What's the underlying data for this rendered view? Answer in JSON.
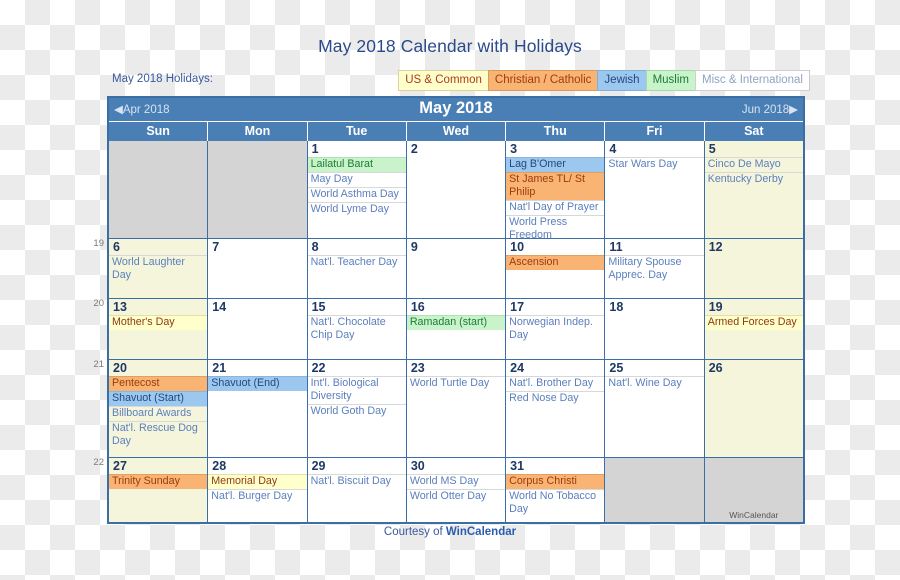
{
  "page": {
    "title": "May 2018 Calendar with Holidays"
  },
  "legend": {
    "label": "May 2018 Holidays:",
    "items": [
      {
        "label": "US & Common",
        "key": "us",
        "color": "#ffffcc"
      },
      {
        "label": "Christian / Catholic",
        "key": "chr",
        "color": "#f9b473"
      },
      {
        "label": "Jewish",
        "key": "jew",
        "color": "#9cc8f0"
      },
      {
        "label": "Muslim",
        "key": "mus",
        "color": "#c9f3cb"
      },
      {
        "label": "Misc & International",
        "key": "misc",
        "color": "#ffffff"
      }
    ]
  },
  "calendar": {
    "prev_label": "◀Apr 2018",
    "month_label": "May 2018",
    "next_label": "Jun 2018▶",
    "day_headers": [
      "Sun",
      "Mon",
      "Tue",
      "Wed",
      "Thu",
      "Fri",
      "Sat"
    ],
    "week_numbers": [
      "19",
      "20",
      "21",
      "22"
    ],
    "brand_cell_text": "WinCalendar",
    "weeks": [
      {
        "days": [
          {
            "num": "",
            "blank": true,
            "events": []
          },
          {
            "num": "",
            "blank": true,
            "events": []
          },
          {
            "num": "1",
            "events": [
              {
                "text": "Lailatul Barat",
                "type": "mus"
              },
              {
                "text": "May Day",
                "type": "misc"
              },
              {
                "text": "World Asthma Day",
                "type": "misc"
              },
              {
                "text": "World Lyme Day",
                "type": "misc"
              }
            ]
          },
          {
            "num": "2",
            "events": []
          },
          {
            "num": "3",
            "events": [
              {
                "text": "Lag B'Omer",
                "type": "jew"
              },
              {
                "text": "St James TL/ St Philip",
                "type": "chr"
              },
              {
                "text": "Nat'l Day of Prayer",
                "type": "misc"
              },
              {
                "text": "World Press Freedom",
                "type": "misc"
              }
            ]
          },
          {
            "num": "4",
            "events": [
              {
                "text": "Star Wars Day",
                "type": "misc"
              }
            ]
          },
          {
            "num": "5",
            "weekend": true,
            "events": [
              {
                "text": "Cinco De Mayo",
                "type": "misc"
              },
              {
                "text": "Kentucky Derby",
                "type": "misc"
              }
            ]
          }
        ]
      },
      {
        "days": [
          {
            "num": "6",
            "weekend": true,
            "events": [
              {
                "text": "World Laughter Day",
                "type": "misc"
              }
            ]
          },
          {
            "num": "7",
            "events": []
          },
          {
            "num": "8",
            "events": [
              {
                "text": "Nat'l. Teacher Day",
                "type": "misc"
              }
            ]
          },
          {
            "num": "9",
            "events": []
          },
          {
            "num": "10",
            "events": [
              {
                "text": "Ascension",
                "type": "chr"
              }
            ]
          },
          {
            "num": "11",
            "events": [
              {
                "text": "Military Spouse Apprec. Day",
                "type": "misc"
              }
            ]
          },
          {
            "num": "12",
            "weekend": true,
            "events": []
          }
        ]
      },
      {
        "days": [
          {
            "num": "13",
            "weekend": true,
            "events": [
              {
                "text": "Mother's Day",
                "type": "us"
              }
            ]
          },
          {
            "num": "14",
            "events": []
          },
          {
            "num": "15",
            "events": [
              {
                "text": "Nat'l. Chocolate Chip Day",
                "type": "misc"
              }
            ]
          },
          {
            "num": "16",
            "events": [
              {
                "text": "Ramadan (start)",
                "type": "mus"
              }
            ]
          },
          {
            "num": "17",
            "events": [
              {
                "text": "Norwegian Indep. Day",
                "type": "misc"
              }
            ]
          },
          {
            "num": "18",
            "events": []
          },
          {
            "num": "19",
            "weekend": true,
            "events": [
              {
                "text": "Armed Forces Day",
                "type": "us"
              }
            ]
          }
        ]
      },
      {
        "days": [
          {
            "num": "20",
            "weekend": true,
            "events": [
              {
                "text": "Pentecost",
                "type": "chr"
              },
              {
                "text": "Shavuot (Start)",
                "type": "jew"
              },
              {
                "text": "Billboard Awards",
                "type": "misc"
              },
              {
                "text": "Nat'l. Rescue Dog Day",
                "type": "misc"
              }
            ]
          },
          {
            "num": "21",
            "events": [
              {
                "text": "Shavuot (End)",
                "type": "jew"
              }
            ]
          },
          {
            "num": "22",
            "events": [
              {
                "text": "Int'l. Biological Diversity",
                "type": "misc"
              },
              {
                "text": "World Goth Day",
                "type": "misc"
              }
            ]
          },
          {
            "num": "23",
            "events": [
              {
                "text": "World Turtle Day",
                "type": "misc"
              }
            ]
          },
          {
            "num": "24",
            "events": [
              {
                "text": "Nat'l. Brother Day",
                "type": "misc"
              },
              {
                "text": "Red Nose Day",
                "type": "misc"
              }
            ]
          },
          {
            "num": "25",
            "events": [
              {
                "text": "Nat'l. Wine Day",
                "type": "misc"
              }
            ]
          },
          {
            "num": "26",
            "weekend": true,
            "events": []
          }
        ]
      },
      {
        "days": [
          {
            "num": "27",
            "weekend": true,
            "events": [
              {
                "text": "Trinity Sunday",
                "type": "chr"
              }
            ]
          },
          {
            "num": "28",
            "events": [
              {
                "text": "Memorial Day",
                "type": "us"
              },
              {
                "text": "Nat'l. Burger Day",
                "type": "misc"
              }
            ]
          },
          {
            "num": "29",
            "events": [
              {
                "text": "Nat'l. Biscuit Day",
                "type": "misc"
              }
            ]
          },
          {
            "num": "30",
            "events": [
              {
                "text": "World MS Day",
                "type": "misc"
              },
              {
                "text": "World Otter Day",
                "type": "misc"
              }
            ]
          },
          {
            "num": "31",
            "events": [
              {
                "text": "Corpus Christi",
                "type": "chr"
              },
              {
                "text": "World No Tobacco Day",
                "type": "misc"
              }
            ]
          },
          {
            "num": "",
            "brand": true,
            "events": []
          },
          {
            "num": "",
            "brand": true,
            "events": []
          }
        ]
      }
    ]
  },
  "footer": {
    "prefix": "Courtesy of ",
    "brand": "WinCalendar"
  }
}
